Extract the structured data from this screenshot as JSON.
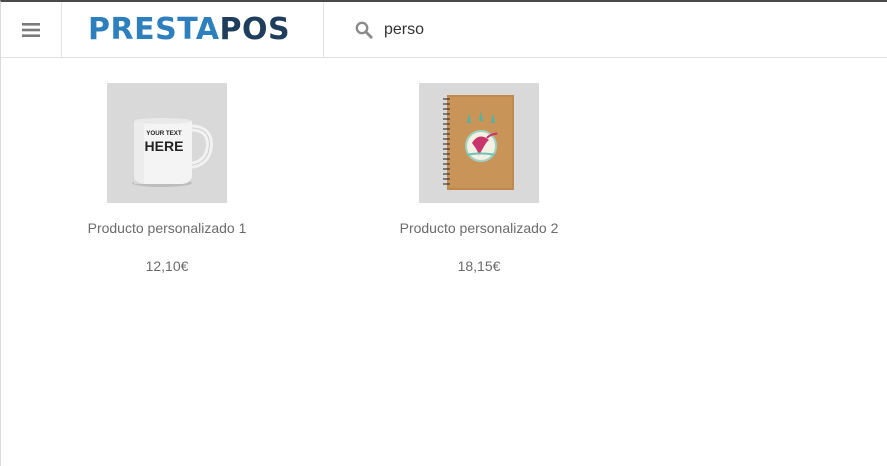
{
  "header": {
    "logo_prefix": "PRESTA",
    "logo_suffix": "POS",
    "menu_icon": "hamburger-menu-icon",
    "search_icon": "search-icon"
  },
  "search": {
    "value": "perso"
  },
  "products": [
    {
      "name": "Producto personalizado 1",
      "price": "12,10€",
      "image_text_line1": "YOUR TEXT",
      "image_text_line2": "HERE"
    },
    {
      "name": "Producto personalizado 2",
      "price": "18,15€"
    }
  ],
  "colors": {
    "logo_blue": "#2d7fbe",
    "logo_navy": "#1f3d5c",
    "text_gray": "#6b6b6b",
    "thumb_bg": "#d9d9d9"
  }
}
